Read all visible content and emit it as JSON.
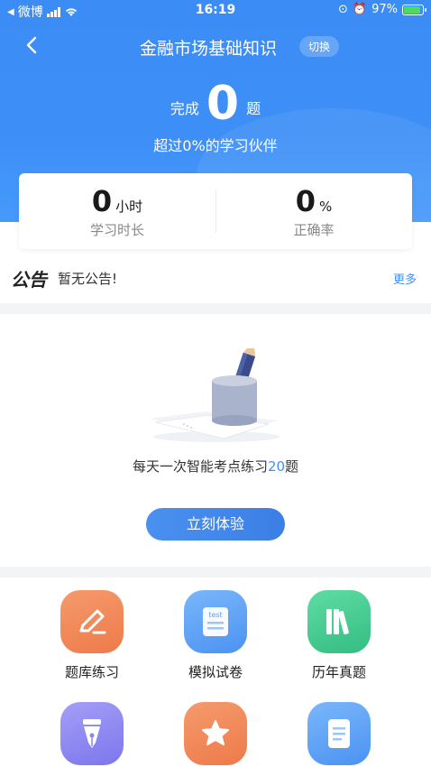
{
  "status_bar": {
    "carrier": "微博",
    "time": "16:19",
    "battery": "97%"
  },
  "nav": {
    "title": "金融市场基础知识",
    "switch_label": "切换"
  },
  "progress": {
    "done_prefix": "完成",
    "done_count": "0",
    "done_suffix": "题",
    "peer_text": "超过0%的学习伙伴"
  },
  "stats": {
    "study_time_value": "0",
    "study_time_unit": "小时",
    "study_time_label": "学习时长",
    "accuracy_value": "0",
    "accuracy_unit": "%",
    "accuracy_label": "正确率"
  },
  "notice": {
    "logo": "公告",
    "text": "暂无公告!",
    "more": "更多"
  },
  "practice": {
    "daily_prefix": "每天一次智能考点练习",
    "daily_count": "20",
    "daily_suffix": "题",
    "cta_label": "立刻体验"
  },
  "menu": {
    "items": [
      {
        "label": "题库练习",
        "icon": "pencil-icon",
        "color": "#f0875a"
      },
      {
        "label": "模拟试卷",
        "icon": "test-paper-icon",
        "color": "#5aa1f5"
      },
      {
        "label": "历年真题",
        "icon": "books-icon",
        "color": "#3ec98d"
      },
      {
        "label": "",
        "icon": "pen-nib-icon",
        "color": "#8b86f0"
      },
      {
        "label": "",
        "icon": "star-icon",
        "color": "#f0875a"
      },
      {
        "label": "",
        "icon": "document-icon",
        "color": "#5aa1f5"
      }
    ]
  },
  "colors": {
    "brand_blue": "#3d8ff7",
    "accent_blue_text": "#3d8ff7"
  }
}
